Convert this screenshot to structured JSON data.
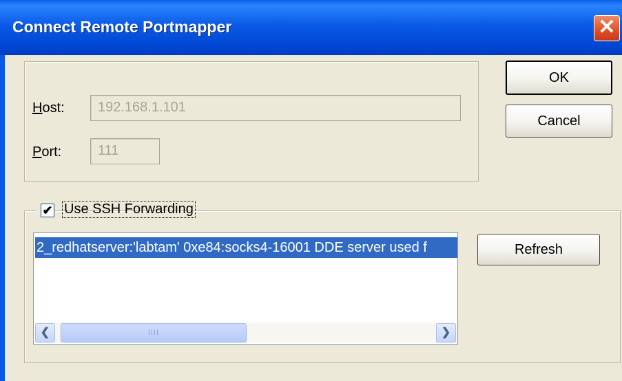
{
  "window": {
    "title": "Connect Remote Portmapper",
    "close_glyph": "✕"
  },
  "host": {
    "label": "Host:",
    "value": "192.168.1.101"
  },
  "port": {
    "label": "Port:",
    "value": "111"
  },
  "buttons": {
    "ok": "OK",
    "cancel": "Cancel",
    "refresh": "Refresh"
  },
  "ssh": {
    "checkbox_label": "Use SSH Forwarding",
    "checked": true,
    "check_glyph": "✔",
    "items": [
      "2_redhatserver:'labtam' 0xe84:socks4-16001 DDE server used f"
    ]
  },
  "scrollbar": {
    "left_arrow": "❮",
    "right_arrow": "❯",
    "grip": "IIII"
  },
  "colors": {
    "titlebar": "#0a5ae6",
    "face": "#ece9d8",
    "selection": "#316ac5",
    "close": "#de4f25"
  }
}
